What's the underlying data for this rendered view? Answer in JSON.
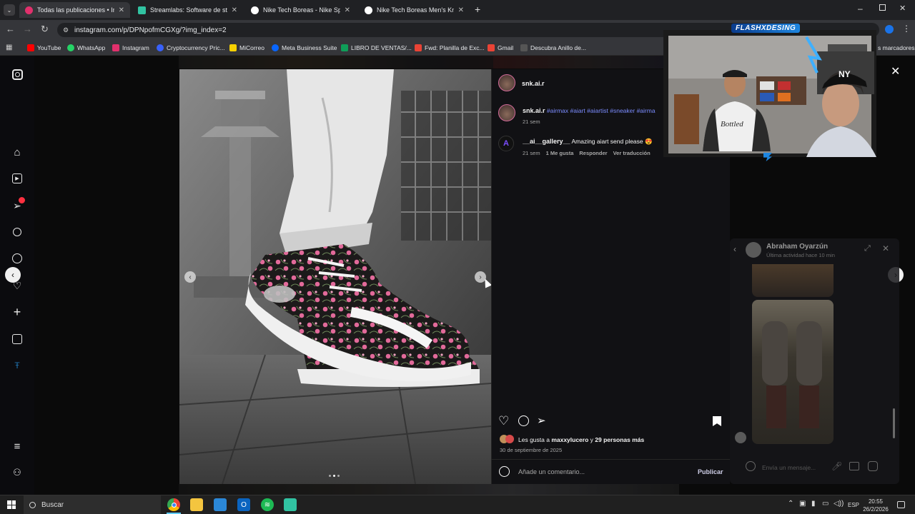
{
  "browser": {
    "tabs": [
      {
        "title": "Todas las publicaciones • Instag",
        "icon_color": "#e1306c",
        "active": true
      },
      {
        "title": "Streamlabs: Software de stream",
        "icon_color": "#31c3a2",
        "active": false
      },
      {
        "title": "Nike Tech Boreas - Nike Sports",
        "icon_color": "#ffffff",
        "active": false
      },
      {
        "title": "Nike Tech Boreas Men's Knit Op",
        "icon_color": "#ffffff",
        "active": false
      }
    ],
    "url": "instagram.com/p/DPNpofmCGXg/?img_index=2",
    "bookmarks": [
      {
        "label": "YouTube",
        "icon": "youtube-icon",
        "color": "#ff0000"
      },
      {
        "label": "WhatsApp",
        "icon": "whatsapp-icon",
        "color": "#25d366"
      },
      {
        "label": "Instagram",
        "icon": "instagram-icon",
        "color": "#e1306c"
      },
      {
        "label": "Cryptocurrency Pric...",
        "icon": "crypto-icon",
        "color": "#3861fb"
      },
      {
        "label": "MiCorreo",
        "icon": "mail-icon",
        "color": "#f7d100"
      },
      {
        "label": "Meta Business Suite",
        "icon": "meta-icon",
        "color": "#0866ff"
      },
      {
        "label": "LIBRO DE VENTAS/...",
        "icon": "sheets-icon",
        "color": "#0f9d58"
      },
      {
        "label": "Fwd: Planilla de Exc...",
        "icon": "gmail-icon",
        "color": "#ea4335"
      },
      {
        "label": "Gmail",
        "icon": "gmail-icon",
        "color": "#ea4335"
      },
      {
        "label": "Descubra Anillo de...",
        "icon": "shop-icon",
        "color": "#555555"
      }
    ],
    "bookmarks_overflow": "s marcadores"
  },
  "post": {
    "username": "snk.ai.r",
    "caption_user": "snk.ai.r",
    "caption_tags": "#airmax #aiart #aiartist #sneaker #airma",
    "caption_time": "21 sem",
    "comment": {
      "user": "__ai__gallery__",
      "text": "Amazing aiart send please 😍",
      "time": "21 sem",
      "likes": "1 Me gusta",
      "reply": "Responder",
      "translate": "Ver traducción"
    },
    "likes_prefix": "Les gusta a ",
    "likes_user": "maxxylucero",
    "likes_mid": " y ",
    "likes_count": "29 personas más",
    "date": "30 de septiembre de 2025",
    "comment_placeholder": "Añade un comentario...",
    "publish_label": "Publicar"
  },
  "webcam": {
    "overlay_name": "FLASHXDESING",
    "cap_text": "NY"
  },
  "chat": {
    "name": "Abraham Oyarzún",
    "status": "Última actividad hace 10 min",
    "placeholder": "Envía un mensaje..."
  },
  "taskbar": {
    "search_label": "Buscar",
    "language": "ESP",
    "time": "20:55",
    "date": "26/2/2026"
  }
}
